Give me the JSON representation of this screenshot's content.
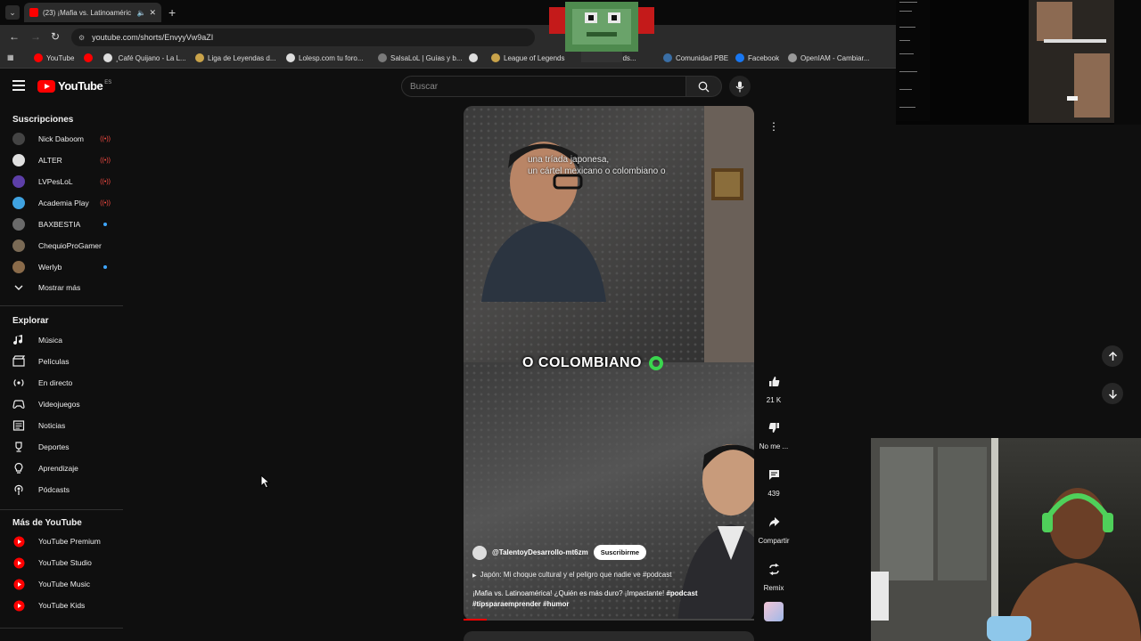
{
  "browser": {
    "tab_title": "(23) ¡Mafia vs. Latinoaméric",
    "url": "youtube.com/shorts/EnvyyVw9aZI",
    "bookmarks": [
      {
        "label": "YouTube",
        "color": "#ff0000"
      },
      {
        "label": "",
        "color": "#ff0000"
      },
      {
        "label": "¸Café Quijano - La L...",
        "color": "#dddddd"
      },
      {
        "label": "Liga de Leyendas d...",
        "color": "#c9a34a"
      },
      {
        "label": "Lolesp.com tu foro...",
        "color": "#dddddd"
      },
      {
        "label": "SalsaLoL | Guías y b...",
        "color": "#7a7a7a"
      },
      {
        "label": "",
        "color": "#dddddd"
      },
      {
        "label": "League of Legends",
        "color": "#c9a34a"
      },
      {
        "label": "...egends...",
        "color": "#c9a34a"
      },
      {
        "label": "Comunidad PBE",
        "color": "#3a6ea5"
      },
      {
        "label": "Facebook",
        "color": "#1877f2"
      },
      {
        "label": "OpenIAM - Cambiar...",
        "color": "#999999"
      }
    ]
  },
  "header": {
    "logo_text": "YouTube",
    "logo_region": "ES",
    "search_placeholder": "Buscar"
  },
  "sidebar": {
    "subscriptions_title": "Suscripciones",
    "subscriptions": [
      {
        "label": "Nick Daboom",
        "avatar": "#444444",
        "status": "live"
      },
      {
        "label": "ALTER",
        "avatar": "#e0e0e0",
        "status": "live"
      },
      {
        "label": "LVPesLoL",
        "avatar": "#5d3fa8",
        "status": "live"
      },
      {
        "label": "Academia Play",
        "avatar": "#3fa2e0",
        "status": "live"
      },
      {
        "label": "BAXBESTIA",
        "avatar": "#6a6a6a",
        "status": "dot"
      },
      {
        "label": "ChequioProGamer",
        "avatar": "#7a6a55",
        "status": ""
      },
      {
        "label": "Werlyb",
        "avatar": "#8a6b4a",
        "status": "dot"
      }
    ],
    "show_more": "Mostrar más",
    "explore_title": "Explorar",
    "explore": [
      {
        "label": "Música",
        "icon": "music-note-icon"
      },
      {
        "label": "Películas",
        "icon": "clapperboard-icon"
      },
      {
        "label": "En directo",
        "icon": "live-broadcast-icon"
      },
      {
        "label": "Videojuegos",
        "icon": "gamepad-icon"
      },
      {
        "label": "Noticias",
        "icon": "newspaper-icon"
      },
      {
        "label": "Deportes",
        "icon": "trophy-icon"
      },
      {
        "label": "Aprendizaje",
        "icon": "lightbulb-icon"
      },
      {
        "label": "Pódcasts",
        "icon": "podcast-icon"
      }
    ],
    "more_title": "Más de YouTube",
    "more": [
      {
        "label": "YouTube Premium"
      },
      {
        "label": "YouTube Studio"
      },
      {
        "label": "YouTube Music"
      },
      {
        "label": "YouTube Kids"
      }
    ]
  },
  "short": {
    "caption_small": "una tríada japonesa,\nun cártel mexicano o colombiano o",
    "caption_big": "O COLOMBIANO",
    "channel": "@TalentoyDesarrollo-mt6zm",
    "subscribe": "Suscribirme",
    "related": "Japón: Mi choque cultural y el peligro que nadie ve #podcast",
    "description": "¡Mafia vs. Latinoamérica! ¿Quién es más duro? ¡Impactante!",
    "hashtags": "#podcast #tipsparaemprender #humor",
    "progress": 0.08
  },
  "actions": {
    "likes": "21 K",
    "dislike": "No me ...",
    "comments": "439",
    "share": "Compartir",
    "remix": "Remix"
  },
  "colors": {
    "brand": "#ff0000",
    "background": "#0f0f0f",
    "live": "#ff4e45",
    "caption_dot": "#3ad64e"
  }
}
